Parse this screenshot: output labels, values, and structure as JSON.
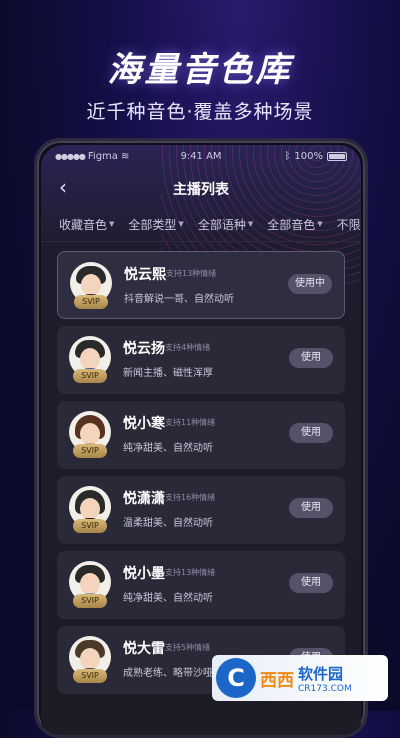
{
  "hero": {
    "title": "海量音色库",
    "subtitle": "近千种音色·覆盖多种场景"
  },
  "status_bar": {
    "carrier": "Figma",
    "time": "9:41 AM",
    "battery": "100%"
  },
  "nav": {
    "title": "主播列表",
    "back_icon": "chevron-left-icon"
  },
  "filters": [
    {
      "label": "收藏音色"
    },
    {
      "label": "全部类型"
    },
    {
      "label": "全部语种"
    },
    {
      "label": "全部音色"
    },
    {
      "label": "不限"
    }
  ],
  "voices": [
    {
      "name": "悦云熙",
      "tag": "支持13种情绪",
      "desc": "抖音解说一哥、自然动听",
      "badge": "SVIP",
      "button": "使用中",
      "active": true
    },
    {
      "name": "悦云扬",
      "tag": "支持4种情绪",
      "desc": "新闻主播、磁性浑厚",
      "badge": "SVIP",
      "button": "使用",
      "active": false
    },
    {
      "name": "悦小寒",
      "tag": "支持11种情绪",
      "desc": "纯净甜美、自然动听",
      "badge": "SVIP",
      "button": "使用",
      "active": false
    },
    {
      "name": "悦潇潇",
      "tag": "支持16种情绪",
      "desc": "温柔甜美、自然动听",
      "badge": "SVIP",
      "button": "使用",
      "active": false
    },
    {
      "name": "悦小墨",
      "tag": "支持13种情绪",
      "desc": "纯净甜美、自然动听",
      "badge": "SVIP",
      "button": "使用",
      "active": false
    },
    {
      "name": "悦大雷",
      "tag": "支持5种情绪",
      "desc": "成熟老练、略带沙哑",
      "badge": "SVIP",
      "button": "使用",
      "active": false
    }
  ],
  "watermark": {
    "brand": "西西",
    "name": "软件园",
    "url": "CR173.COM"
  },
  "colors": {
    "accent": "#5b5a72",
    "svip_gold": "#d9b979",
    "background": "#15104a"
  }
}
